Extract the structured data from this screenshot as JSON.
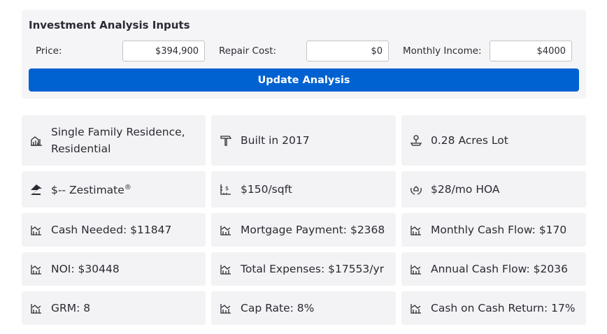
{
  "panel": {
    "title": "Investment Analysis Inputs",
    "price_label": "Price:",
    "price_value": "$394,900",
    "repair_label": "Repair Cost:",
    "repair_value": "$0",
    "income_label": "Monthly Income:",
    "income_value": "$4000",
    "button_label": "Update Analysis"
  },
  "facts": {
    "home_type": "Single Family Residence, Residential",
    "year_built": "Built in 2017",
    "lot": "0.28 Acres Lot",
    "zestimate": "$-- Zestimate",
    "zestimate_mark": "®",
    "price_sqft": "$150/sqft",
    "hoa": "$28/mo HOA"
  },
  "metrics": {
    "cash_needed": "Cash Needed: $11847",
    "mortgage": "Mortgage Payment: $2368",
    "monthly_cash_flow": "Monthly Cash Flow: $170",
    "noi": "NOI: $30448",
    "total_expenses": "Total Expenses: $17553/yr",
    "annual_cash_flow": "Annual Cash Flow: $2036",
    "grm": "GRM: 8",
    "cap_rate": "Cap Rate: 8%",
    "coc_return": "Cash on Cash Return: 17%"
  },
  "colors": {
    "accent": "#0062d1",
    "panel_bg": "#f5f5f7",
    "card_bg": "#f3f3f5",
    "text": "#2a2a33"
  },
  "icons": {
    "home_type": "building-chart-icon",
    "year_built": "hammer-icon",
    "lot": "lot-pin-icon",
    "zestimate": "zillow-z-icon",
    "price_sqft": "ruler-dollar-icon",
    "hoa": "hands-house-icon",
    "metric": "trend-chart-icon"
  }
}
